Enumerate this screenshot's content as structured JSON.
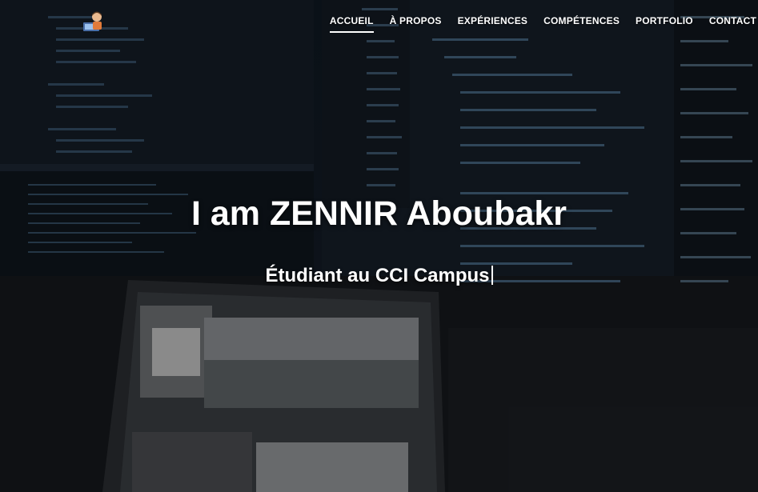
{
  "nav": {
    "items": [
      {
        "label": "ACCUEIL",
        "active": true
      },
      {
        "label": "À PROPOS",
        "active": false
      },
      {
        "label": "EXPÉRIENCES",
        "active": false
      },
      {
        "label": "COMPÉTENCES",
        "active": false
      },
      {
        "label": "PORTFOLIO",
        "active": false
      },
      {
        "label": "CONTACT",
        "active": false
      }
    ]
  },
  "logo": {
    "icon": "developer-avatar-icon"
  },
  "hero": {
    "title": "I am ZENNIR Aboubakr",
    "subtitle": "Étudiant au CCI Campus"
  },
  "colors": {
    "text": "#ffffff",
    "background": "#0f1822"
  }
}
